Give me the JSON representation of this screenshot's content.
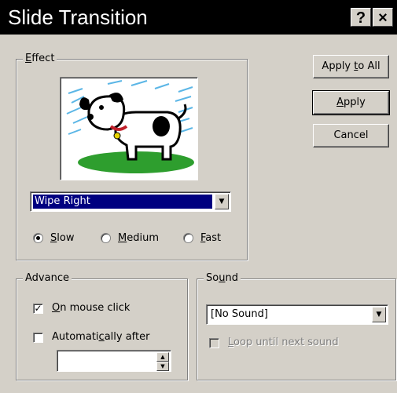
{
  "window": {
    "title": "Slide Transition",
    "help_glyph": "?",
    "close_glyph": "×"
  },
  "effect": {
    "group_label": "Effect",
    "group_label_access_key": "E",
    "preview_image": "dog-icon",
    "transition": "Wipe Right",
    "speed_options": [
      {
        "label": "Slow",
        "access_key": "S",
        "selected": true
      },
      {
        "label": "Medium",
        "access_key": "M",
        "selected": false
      },
      {
        "label": "Fast",
        "access_key": "F",
        "selected": false
      }
    ]
  },
  "buttons": {
    "apply_to_all": "Apply to All",
    "apply": "Apply",
    "cancel": "Cancel"
  },
  "advance": {
    "group_label": "Advance",
    "on_mouse_click": {
      "label": "On mouse click",
      "checked": true
    },
    "automatically_after": {
      "label": "Automatically after",
      "checked": false,
      "value": ""
    }
  },
  "sound": {
    "group_label": "Sound",
    "selected": "[No Sound]",
    "loop": {
      "label": "Loop until next sound",
      "checked": false,
      "disabled": true
    }
  },
  "colors": {
    "selection": "#000080",
    "face": "#d4d0c8"
  }
}
